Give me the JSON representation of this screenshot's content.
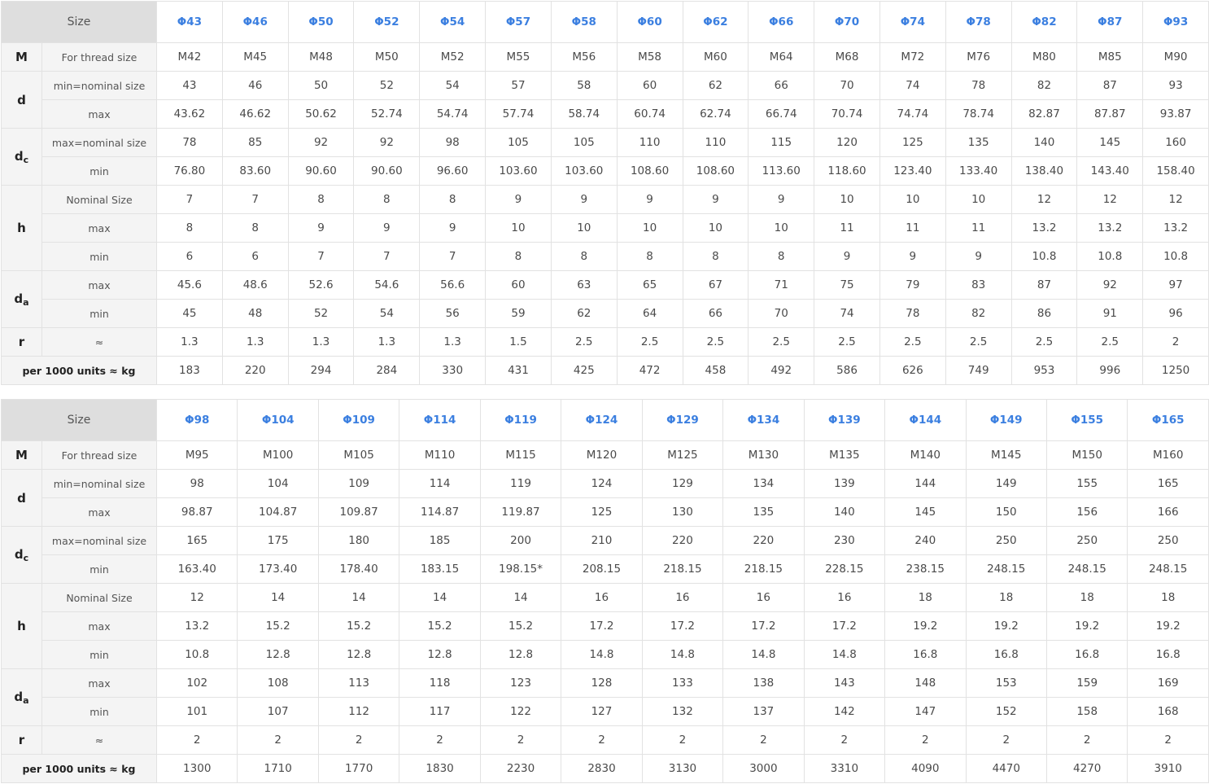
{
  "row_labels": {
    "size": "Size",
    "M": {
      "symbol": "M",
      "sub": "For thread size"
    },
    "d": {
      "symbol": "d",
      "sub1": "min=nominal size",
      "sub2": "max"
    },
    "dc": {
      "symbol": "d",
      "subscript": "c",
      "sub1": "max=nominal size",
      "sub2": "min"
    },
    "h": {
      "symbol": "h",
      "sub1": "Nominal Size",
      "sub2": "max",
      "sub3": "min"
    },
    "da": {
      "symbol": "d",
      "subscript": "a",
      "sub1": "max",
      "sub2": "min"
    },
    "r": {
      "symbol": "r",
      "sub": "≈"
    },
    "weight": "per 1000 units ≈ kg"
  },
  "tables": [
    {
      "headers": [
        "Φ43",
        "Φ46",
        "Φ50",
        "Φ52",
        "Φ54",
        "Φ57",
        "Φ58",
        "Φ60",
        "Φ62",
        "Φ66",
        "Φ70",
        "Φ74",
        "Φ78",
        "Φ82",
        "Φ87",
        "Φ93"
      ],
      "rows": [
        [
          "M42",
          "M45",
          "M48",
          "M50",
          "M52",
          "M55",
          "M56",
          "M58",
          "M60",
          "M64",
          "M68",
          "M72",
          "M76",
          "M80",
          "M85",
          "M90"
        ],
        [
          "43",
          "46",
          "50",
          "52",
          "54",
          "57",
          "58",
          "60",
          "62",
          "66",
          "70",
          "74",
          "78",
          "82",
          "87",
          "93"
        ],
        [
          "43.62",
          "46.62",
          "50.62",
          "52.74",
          "54.74",
          "57.74",
          "58.74",
          "60.74",
          "62.74",
          "66.74",
          "70.74",
          "74.74",
          "78.74",
          "82.87",
          "87.87",
          "93.87"
        ],
        [
          "78",
          "85",
          "92",
          "92",
          "98",
          "105",
          "105",
          "110",
          "110",
          "115",
          "120",
          "125",
          "135",
          "140",
          "145",
          "160"
        ],
        [
          "76.80",
          "83.60",
          "90.60",
          "90.60",
          "96.60",
          "103.60",
          "103.60",
          "108.60",
          "108.60",
          "113.60",
          "118.60",
          "123.40",
          "133.40",
          "138.40",
          "143.40",
          "158.40"
        ],
        [
          "7",
          "7",
          "8",
          "8",
          "8",
          "9",
          "9",
          "9",
          "9",
          "9",
          "10",
          "10",
          "10",
          "12",
          "12",
          "12"
        ],
        [
          "8",
          "8",
          "9",
          "9",
          "9",
          "10",
          "10",
          "10",
          "10",
          "10",
          "11",
          "11",
          "11",
          "13.2",
          "13.2",
          "13.2"
        ],
        [
          "6",
          "6",
          "7",
          "7",
          "7",
          "8",
          "8",
          "8",
          "8",
          "8",
          "9",
          "9",
          "9",
          "10.8",
          "10.8",
          "10.8"
        ],
        [
          "45.6",
          "48.6",
          "52.6",
          "54.6",
          "56.6",
          "60",
          "63",
          "65",
          "67",
          "71",
          "75",
          "79",
          "83",
          "87",
          "92",
          "97"
        ],
        [
          "45",
          "48",
          "52",
          "54",
          "56",
          "59",
          "62",
          "64",
          "66",
          "70",
          "74",
          "78",
          "82",
          "86",
          "91",
          "96"
        ],
        [
          "1.3",
          "1.3",
          "1.3",
          "1.3",
          "1.3",
          "1.5",
          "2.5",
          "2.5",
          "2.5",
          "2.5",
          "2.5",
          "2.5",
          "2.5",
          "2.5",
          "2.5",
          "2"
        ],
        [
          "183",
          "220",
          "294",
          "284",
          "330",
          "431",
          "425",
          "472",
          "458",
          "492",
          "586",
          "626",
          "749",
          "953",
          "996",
          "1250"
        ]
      ]
    },
    {
      "headers": [
        "Φ98",
        "Φ104",
        "Φ109",
        "Φ114",
        "Φ119",
        "Φ124",
        "Φ129",
        "Φ134",
        "Φ139",
        "Φ144",
        "Φ149",
        "Φ155",
        "Φ165"
      ],
      "rows": [
        [
          "M95",
          "M100",
          "M105",
          "M110",
          "M115",
          "M120",
          "M125",
          "M130",
          "M135",
          "M140",
          "M145",
          "M150",
          "M160"
        ],
        [
          "98",
          "104",
          "109",
          "114",
          "119",
          "124",
          "129",
          "134",
          "139",
          "144",
          "149",
          "155",
          "165"
        ],
        [
          "98.87",
          "104.87",
          "109.87",
          "114.87",
          "119.87",
          "125",
          "130",
          "135",
          "140",
          "145",
          "150",
          "156",
          "166"
        ],
        [
          "165",
          "175",
          "180",
          "185",
          "200",
          "210",
          "220",
          "220",
          "230",
          "240",
          "250",
          "250",
          "250"
        ],
        [
          "163.40",
          "173.40",
          "178.40",
          "183.15",
          "198.15*",
          "208.15",
          "218.15",
          "218.15",
          "228.15",
          "238.15",
          "248.15",
          "248.15",
          "248.15"
        ],
        [
          "12",
          "14",
          "14",
          "14",
          "14",
          "16",
          "16",
          "16",
          "16",
          "18",
          "18",
          "18",
          "18"
        ],
        [
          "13.2",
          "15.2",
          "15.2",
          "15.2",
          "15.2",
          "17.2",
          "17.2",
          "17.2",
          "17.2",
          "19.2",
          "19.2",
          "19.2",
          "19.2"
        ],
        [
          "10.8",
          "12.8",
          "12.8",
          "12.8",
          "12.8",
          "14.8",
          "14.8",
          "14.8",
          "14.8",
          "16.8",
          "16.8",
          "16.8",
          "16.8"
        ],
        [
          "102",
          "108",
          "113",
          "118",
          "123",
          "128",
          "133",
          "138",
          "143",
          "148",
          "153",
          "159",
          "169"
        ],
        [
          "101",
          "107",
          "112",
          "117",
          "122",
          "127",
          "132",
          "137",
          "142",
          "147",
          "152",
          "158",
          "168"
        ],
        [
          "2",
          "2",
          "2",
          "2",
          "2",
          "2",
          "2",
          "2",
          "2",
          "2",
          "2",
          "2",
          "2"
        ],
        [
          "1300",
          "1710",
          "1770",
          "1830",
          "2230",
          "2830",
          "3130",
          "3000",
          "3310",
          "4090",
          "4470",
          "4270",
          "3910"
        ]
      ]
    }
  ]
}
